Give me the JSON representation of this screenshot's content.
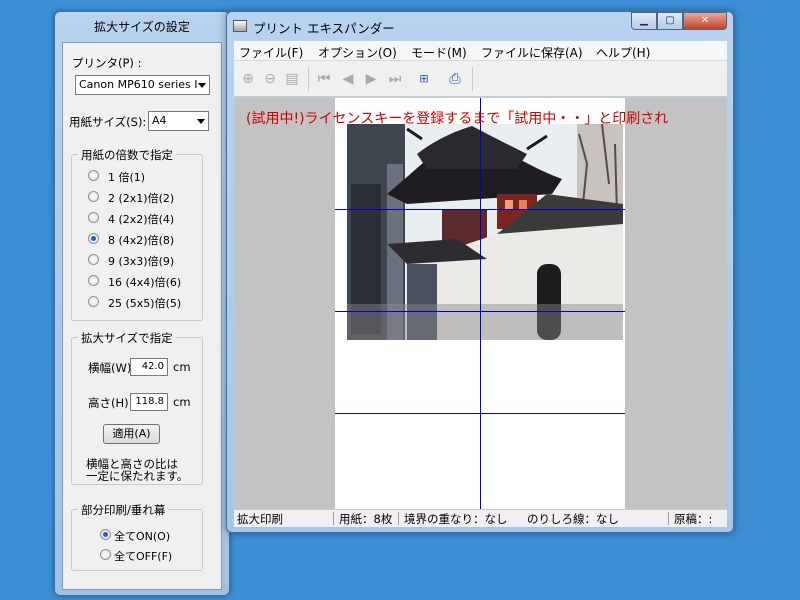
{
  "settings": {
    "title": "拡大サイズの設定",
    "printer_label": "プリンタ(P) :",
    "printer_value": "Canon MP610 series I",
    "paper_label": "用紙サイズ(S):",
    "paper_value": "A4",
    "multiplier_group": "用紙の倍数で指定",
    "multipliers": [
      {
        "label": "1 倍(1)",
        "checked": false
      },
      {
        "label": "2 (2x1)倍(2)",
        "checked": false
      },
      {
        "label": "4 (2x2)倍(4)",
        "checked": false
      },
      {
        "label": "8 (4x2)倍(8)",
        "checked": true
      },
      {
        "label": "9 (3x3)倍(9)",
        "checked": false
      },
      {
        "label": "16 (4x4)倍(6)",
        "checked": false
      },
      {
        "label": "25 (5x5)倍(5)",
        "checked": false
      }
    ],
    "size_group": "拡大サイズで指定",
    "width_label": "横幅(W)",
    "width_value": "42.0",
    "height_label": "高さ(H)",
    "height_value": "118.8",
    "unit": "cm",
    "apply_button": "適用(A)",
    "ratio_note_1": "横幅と高さの比は",
    "ratio_note_2": "一定に保たれます。",
    "partial_group": "部分印刷/垂れ幕",
    "all_on": "全てON(O)",
    "all_off": "全てOFF(F)",
    "all_on_checked": true
  },
  "main": {
    "title": "プリント エキスパンダー",
    "menu": [
      "ファイル(F)",
      "オプション(O)",
      "モード(M)",
      "ファイルに保存(A)",
      "ヘルプ(H)"
    ],
    "toolbar_icons": [
      "zoom-in-icon",
      "zoom-out-icon",
      "page-icon",
      "first-page-icon",
      "prev-page-icon",
      "next-page-icon",
      "last-page-icon",
      "layout-icon",
      "printer-icon"
    ],
    "watermark": "(試用中!)ライセンスキーを登録するまで「試用中・・」と印刷され",
    "status": {
      "mode": "拡大印刷",
      "sheets": "用紙：8枚",
      "overlap": "境界の重なり：なし",
      "glue_line": "のりしろ線：なし",
      "original": "原稿：:"
    }
  },
  "colors": {
    "desktop": "#3c8ed6",
    "grid_line": "#0000cc",
    "watermark": "#cc0000"
  }
}
